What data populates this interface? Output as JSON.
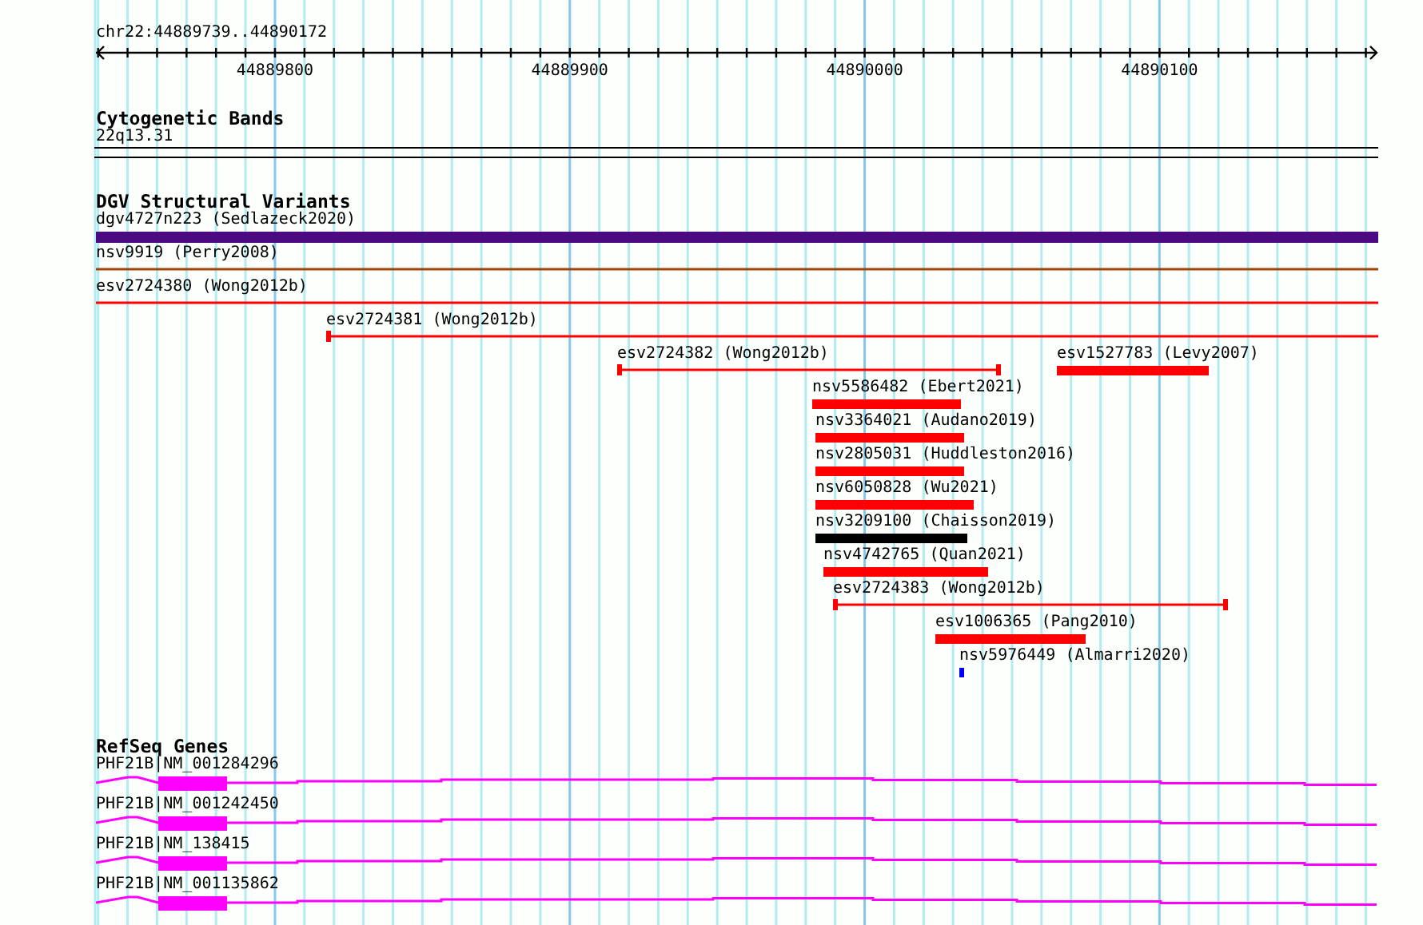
{
  "ruler": {
    "location": "chr22:44889739..44890172",
    "ticks": [
      "44889800",
      "44889900",
      "44890000",
      "44890100"
    ]
  },
  "tracks": [
    {
      "title": "Cytogenetic Bands",
      "kind": "bands",
      "features": [
        {
          "label": "22q13.31"
        }
      ]
    },
    {
      "title": "DGV Structural Variants",
      "kind": "variants",
      "features": [
        {
          "label": "dgv4727n223 (Sedlazeck2020)",
          "kind": "bar",
          "color": "#4b0a82"
        },
        {
          "label": "nsv9919 (Perry2008)",
          "kind": "line",
          "color": "#a0460a"
        },
        {
          "label": "esv2724380 (Wong2012b)",
          "kind": "line",
          "color": "#ff0000"
        },
        {
          "label": "esv2724381 (Wong2012b)",
          "kind": "line",
          "color": "#ff0000"
        },
        {
          "label": "esv2724382 (Wong2012b)",
          "kind": "line",
          "color": "#ff0000"
        },
        {
          "label": "esv1527783 (Levy2007)",
          "kind": "bar",
          "color": "#ff0000"
        },
        {
          "label": "nsv5586482 (Ebert2021)",
          "kind": "bar",
          "color": "#ff0000"
        },
        {
          "label": "nsv3364021 (Audano2019)",
          "kind": "bar",
          "color": "#ff0000"
        },
        {
          "label": "nsv2805031 (Huddleston2016)",
          "kind": "bar",
          "color": "#ff0000"
        },
        {
          "label": "nsv6050828 (Wu2021)",
          "kind": "bar",
          "color": "#ff0000"
        },
        {
          "label": "nsv3209100 (Chaisson2019)",
          "kind": "bar",
          "color": "#000000"
        },
        {
          "label": "nsv4742765 (Quan2021)",
          "kind": "bar",
          "color": "#ff0000"
        },
        {
          "label": "esv2724383 (Wong2012b)",
          "kind": "line",
          "color": "#ff0000"
        },
        {
          "label": "esv1006365 (Pang2010)",
          "kind": "bar",
          "color": "#ff0000"
        },
        {
          "label": "nsv5976449 (Almarri2020)",
          "kind": "bar",
          "color": "#0000ff"
        }
      ]
    },
    {
      "title": "RefSeq Genes",
      "kind": "genes",
      "features": [
        {
          "label": "PHF21B|NM_001284296"
        },
        {
          "label": "PHF21B|NM_001242450"
        },
        {
          "label": "PHF21B|NM_138415"
        },
        {
          "label": "PHF21B|NM_001135862"
        }
      ]
    }
  ]
}
